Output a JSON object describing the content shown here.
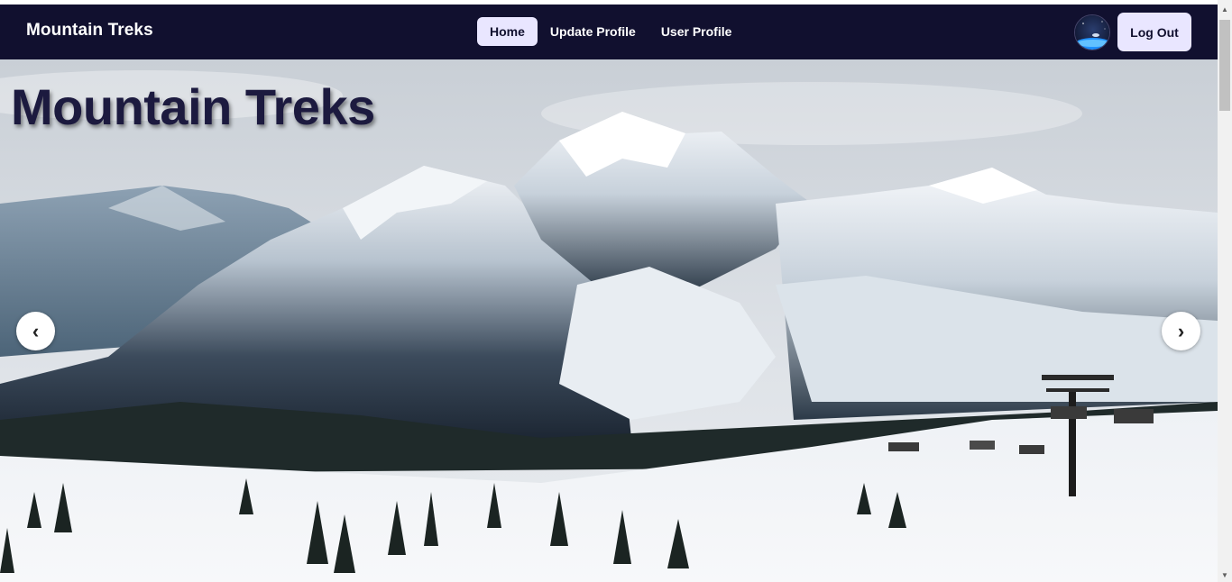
{
  "navbar": {
    "brand": "Mountain Treks",
    "links": [
      {
        "label": "Home",
        "active": true
      },
      {
        "label": "Update Profile",
        "active": false
      },
      {
        "label": "User Profile",
        "active": false
      }
    ],
    "logout_label": "Log Out"
  },
  "hero": {
    "title": "Mountain Treks",
    "prev_glyph": "‹",
    "next_glyph": "›"
  },
  "colors": {
    "navbar_bg": "#11102f",
    "button_bg": "#e9e6ff",
    "hero_title": "#1c1a3f"
  },
  "icons": {
    "avatar": "earth-avatar-icon",
    "prev": "chevron-left-icon",
    "next": "chevron-right-icon"
  }
}
